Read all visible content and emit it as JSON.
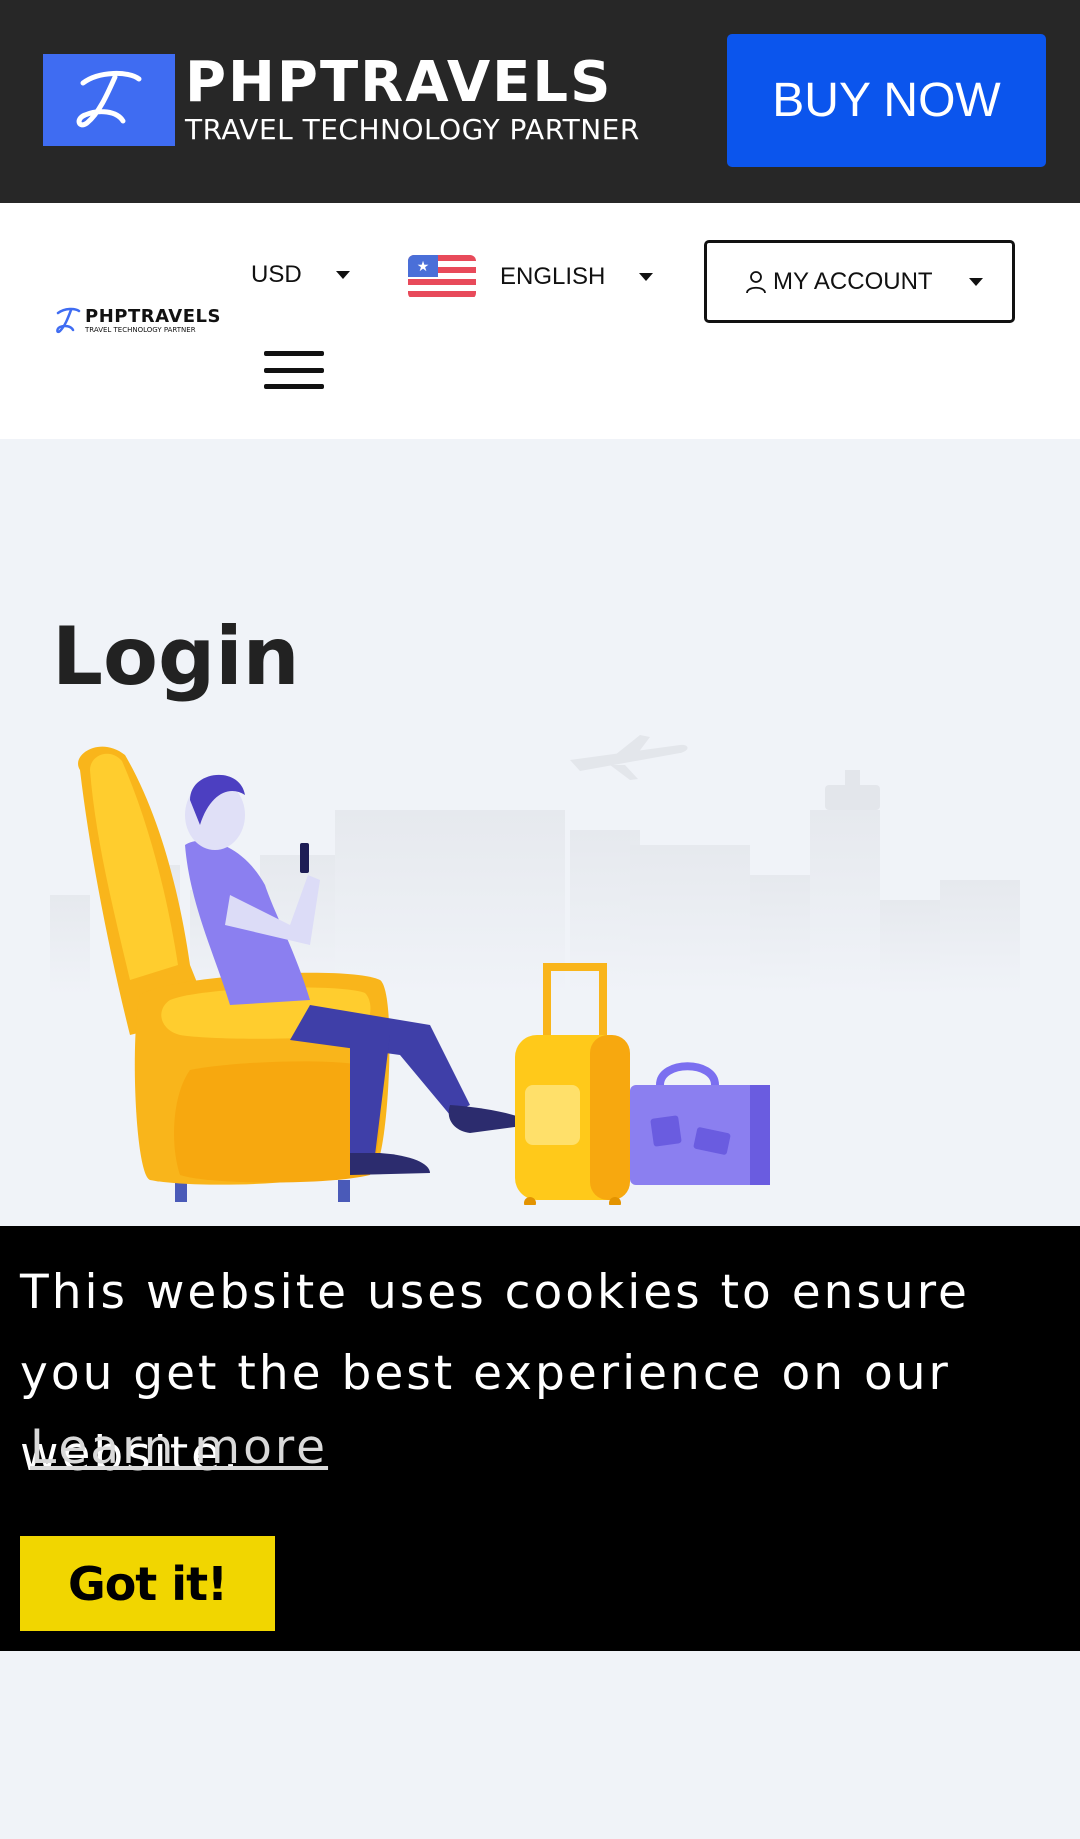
{
  "top_banner": {
    "brand_title": "PHPTRAVELS",
    "brand_subtitle": "TRAVEL TECHNOLOGY PARTNER",
    "buy_now_label": "BUY NOW"
  },
  "header": {
    "logo_title": "PHPTRAVELS",
    "logo_subtitle": "TRAVEL TECHNOLOGY PARTNER",
    "currency": "USD",
    "language": "ENGLISH",
    "account_label": "MY ACCOUNT",
    "menu_icon": "hamburger-menu-icon"
  },
  "main": {
    "page_title": "Login"
  },
  "cookie_banner": {
    "message": "This website uses cookies to ensure you get the best experience on our website.",
    "learn_more": "Learn more",
    "accept_label": "Got it!"
  },
  "colors": {
    "banner_bg": "#272727",
    "buy_now_bg": "#0b55ed",
    "page_bg": "#f0f3f8",
    "cookie_bg": "#000000",
    "cookie_button": "#f1d600"
  }
}
